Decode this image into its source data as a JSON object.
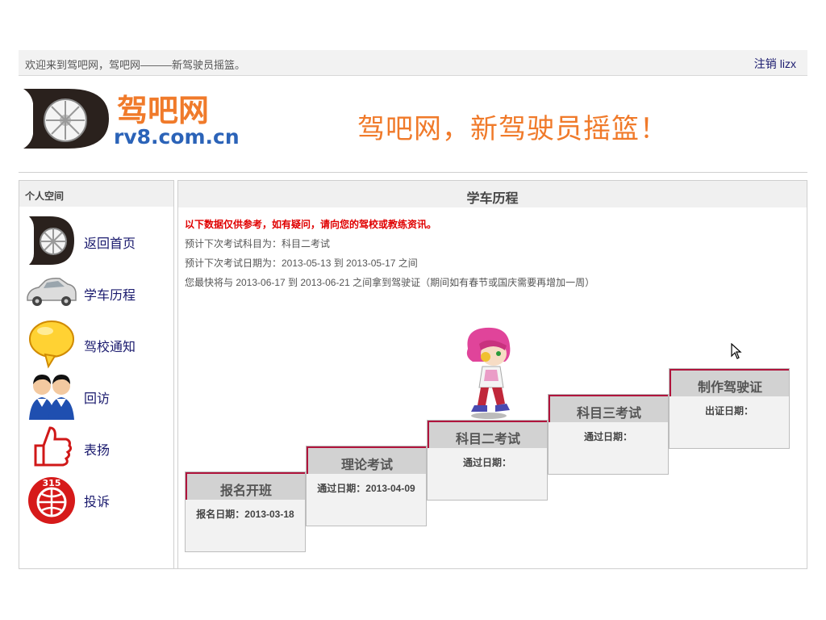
{
  "topbar": {
    "welcome": "欢迎来到驾吧网，驾吧网———新驾驶员摇篮。",
    "logout_label": "注销",
    "username": "lizx"
  },
  "header": {
    "logo_text": "驾吧网",
    "logo_domain": "rv8.com.cn",
    "slogan": "驾吧网，新驾驶员摇篮！"
  },
  "sidebar": {
    "title": "个人空间",
    "items": [
      {
        "label": "返回首页",
        "icon": "logo-d-icon"
      },
      {
        "label": "学车历程",
        "icon": "car-icon"
      },
      {
        "label": "驾校通知",
        "icon": "speech-bubble-icon"
      },
      {
        "label": "回访",
        "icon": "support-agents-icon"
      },
      {
        "label": "表扬",
        "icon": "thumbs-up-icon"
      },
      {
        "label": "投诉",
        "icon": "315-badge-icon"
      }
    ]
  },
  "main": {
    "title": "学车历程",
    "notice": "以下数据仅供参考，如有疑问，请向您的驾校或教练资讯。",
    "info_lines": [
      "预计下次考试科目为：科目二考试",
      "预计下次考试日期为：2013-05-13 到 2013-05-17 之间",
      "您最快将与 2013-06-17 到 2013-06-21 之间拿到驾驶证（期间如有春节或国庆需要再增加一周）"
    ],
    "steps": [
      {
        "title": "报名开班",
        "date_label": "报名日期：2013-03-18"
      },
      {
        "title": "理论考试",
        "date_label": "通过日期：2013-04-09"
      },
      {
        "title": "科目二考试",
        "date_label": "通过日期："
      },
      {
        "title": "科目三考试",
        "date_label": "通过日期："
      },
      {
        "title": "制作驾驶证",
        "date_label": "出证日期："
      }
    ]
  },
  "colors": {
    "accent_orange": "#f07a2a",
    "step_border": "#b0143c",
    "notice_red": "#e00000",
    "link_navy": "#1a1a6e"
  }
}
